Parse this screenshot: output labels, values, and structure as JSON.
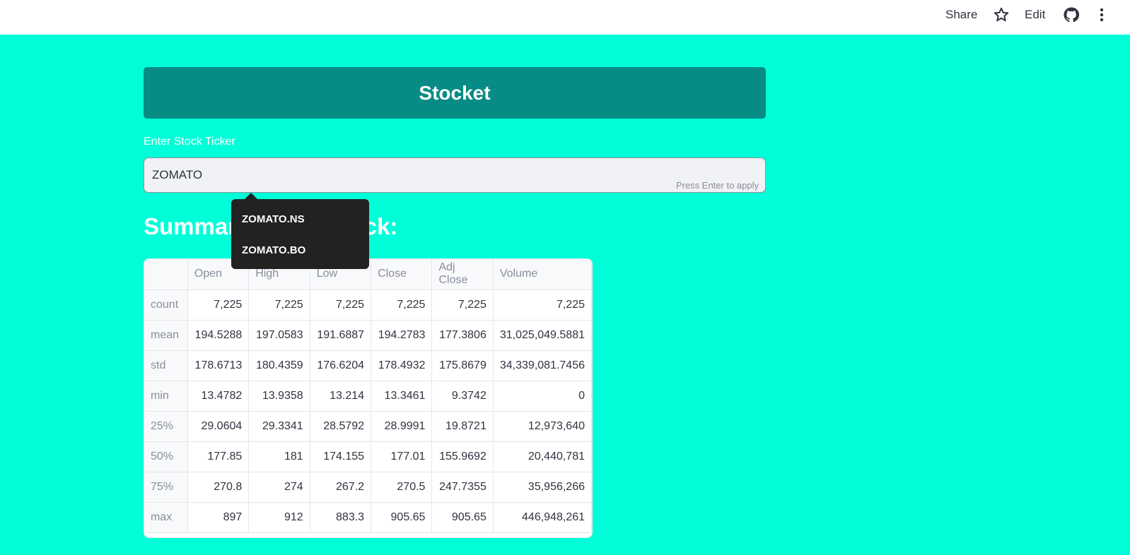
{
  "topbar": {
    "share_label": "Share",
    "edit_label": "Edit",
    "icons": [
      "star-icon",
      "github-icon",
      "more-vertical-icon"
    ]
  },
  "app": {
    "title": "Stocket",
    "input_label": "Enter Stock Ticker",
    "input_value": "ZOMATO",
    "input_hint": "Press Enter to apply",
    "section_title": "Summary of the Stock:"
  },
  "dropdown": {
    "options": [
      "ZOMATO.NS",
      "ZOMATO.BO"
    ]
  },
  "table": {
    "columns": [
      "",
      "Open",
      "High",
      "Low",
      "Close",
      "Adj Close",
      "Volume"
    ],
    "rows": [
      {
        "label": "count",
        "values": [
          "7,225",
          "7,225",
          "7,225",
          "7,225",
          "7,225",
          "7,225"
        ]
      },
      {
        "label": "mean",
        "values": [
          "194.5288",
          "197.0583",
          "191.6887",
          "194.2783",
          "177.3806",
          "31,025,049.5881"
        ]
      },
      {
        "label": "std",
        "values": [
          "178.6713",
          "180.4359",
          "176.6204",
          "178.4932",
          "175.8679",
          "34,339,081.7456"
        ]
      },
      {
        "label": "min",
        "values": [
          "13.4782",
          "13.9358",
          "13.214",
          "13.3461",
          "9.3742",
          "0"
        ]
      },
      {
        "label": "25%",
        "values": [
          "29.0604",
          "29.3341",
          "28.5792",
          "28.9991",
          "19.8721",
          "12,973,640"
        ]
      },
      {
        "label": "50%",
        "values": [
          "177.85",
          "181",
          "174.155",
          "177.01",
          "155.9692",
          "20,440,781"
        ]
      },
      {
        "label": "75%",
        "values": [
          "270.8",
          "274",
          "267.2",
          "270.5",
          "247.7355",
          "35,956,266"
        ]
      },
      {
        "label": "max",
        "values": [
          "897",
          "912",
          "883.3",
          "905.65",
          "905.65",
          "446,948,261"
        ]
      }
    ]
  }
}
